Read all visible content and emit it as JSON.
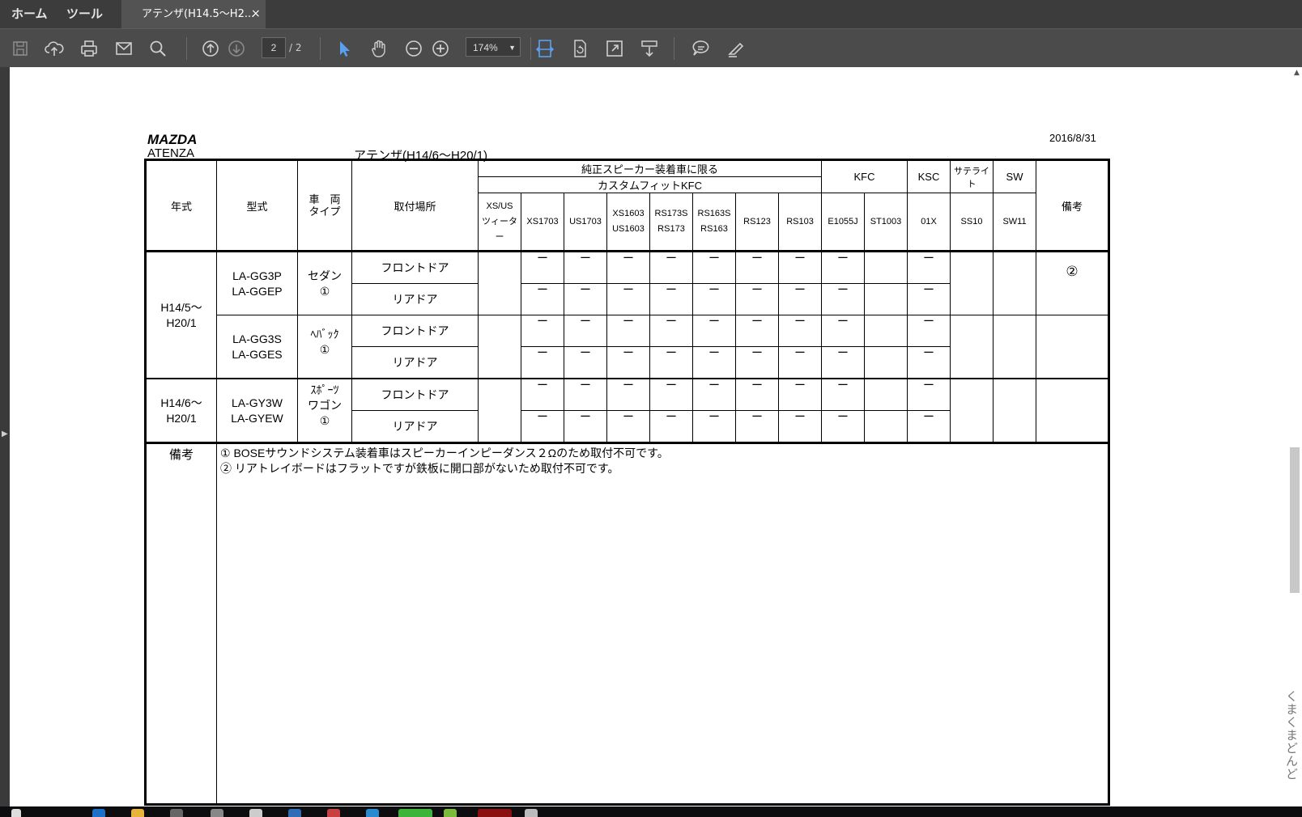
{
  "tabbar": {
    "home_label": "ホーム",
    "tools_label": "ツール",
    "doc_tab_title": "アテンザ(H14.5〜H2...",
    "close_glyph": "×"
  },
  "toolbar": {
    "icons": [
      "save-icon",
      "cloud-upload-icon",
      "print-icon",
      "email-icon",
      "search-icon",
      "page-up-icon",
      "page-down-icon",
      "select-cursor-icon",
      "hand-tool-icon",
      "zoom-out-icon",
      "zoom-in-icon",
      "fit-page-icon",
      "rotate-page-icon",
      "fullscreen-icon",
      "scroll-mode-icon",
      "comment-icon",
      "highlight-pen-icon"
    ],
    "current_page": "2",
    "page_total": "/ 2",
    "zoom": "174%",
    "accent_color": "#5aa0f0"
  },
  "document": {
    "brand": "MAZDA",
    "model": "ATENZA",
    "title": "アテンザ(H14/6〜H20/1)",
    "date": "2016/8/31",
    "table": {
      "headers": {
        "year": "年式",
        "type": "型式",
        "vehicle_type": "車　両\nタイプ",
        "location": "取付場所",
        "genuine_only": "純正スピーカー装着車に限る",
        "custom_fit": "カスタムフィットKFC",
        "kfc": "KFC",
        "ksc": "KSC",
        "satellite": "サテライト",
        "sw": "SW",
        "notes": "備考",
        "columns": [
          "XS/US\nツィーター",
          "XS1703",
          "US1703",
          "XS1603\nUS1603",
          "RS173S\nRS173",
          "RS163S\nRS163",
          "RS123",
          "RS103",
          "E1055J",
          "ST1003",
          "01X",
          "SS10",
          "SW11"
        ]
      },
      "groups": [
        {
          "year": "H14/5〜\nH20/1",
          "type": "LA-GG3P\nLA-GGEP",
          "vehicle": "セダン\n①",
          "note": "②"
        },
        {
          "type": "LA-GG3S\nLA-GGES",
          "vehicle": "ﾍﾊﾞｯｸ\n①"
        },
        {
          "year": "H14/6〜\nH20/1",
          "type": "LA-GY3W\nLA-GYEW",
          "vehicle": "ｽﾎﾟｰﾂ\nワゴン\n①"
        }
      ],
      "locations": [
        "フロントドア",
        "リアドア"
      ],
      "dash": "ー",
      "notes_label": "備考",
      "notes": [
        "① BOSEサウンドシステム装着車はスピーカーインピーダンス２Ωのため取付不可です。",
        "② リアトレイボードはフラットですが鉄板に開口部がないため取付不可です。"
      ]
    }
  },
  "sidebar_vertical_text": "くまくまどんど"
}
